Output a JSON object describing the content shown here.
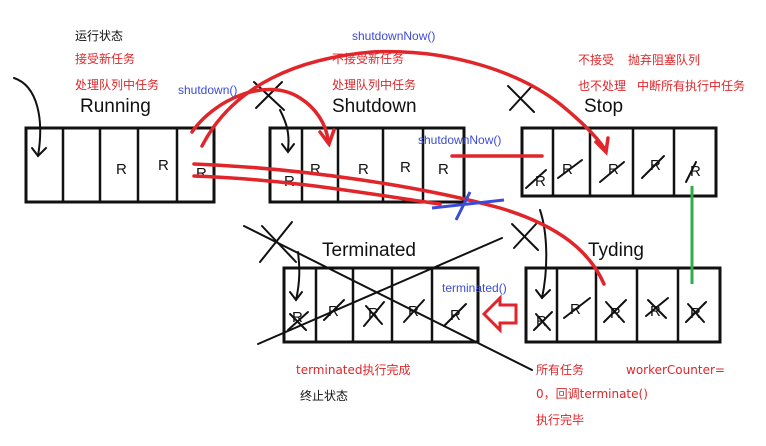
{
  "notes": {
    "running_state": "运行状态",
    "running_accept": "接受新任务",
    "running_process": "处理队列中任务",
    "shutdown_no_accept": "不接受新任务",
    "shutdown_process": "处理队列中任务",
    "stop_no_accept": "不接受",
    "stop_discard": "抛弃阻塞队列",
    "stop_no_process": "也不处理",
    "stop_interrupt": "中断所有执行中任务",
    "terminated_done": "terminated执行完成",
    "terminated_final": "终止状态",
    "tyding_all_tasks": "所有任务",
    "tyding_worker_counter": "workerCounter=",
    "tyding_callback": "0，回调terminate()",
    "tyding_done": "执行完毕"
  },
  "states": {
    "running": "Running",
    "shutdown": "Shutdown",
    "stop": "Stop",
    "terminated": "Terminated",
    "tyding": "Tyding"
  },
  "transitions": {
    "shutdown_call": "shutdown()",
    "shutdown_now_call_top": "shutdownNow()",
    "shutdown_now_call_mid": "shutdownNow()",
    "terminated_call": "terminated()"
  },
  "cells": {
    "running": [
      "",
      "",
      "R",
      "R",
      "R"
    ],
    "shutdown": [
      "R",
      "R",
      "R",
      "R",
      "R"
    ],
    "stop": [
      "R",
      "R",
      "R",
      "R",
      "R"
    ],
    "terminated": [
      "R",
      "R",
      "R",
      "R",
      "R"
    ],
    "tyding": [
      "R",
      "R",
      "R",
      "R",
      "R"
    ]
  },
  "colors": {
    "red": "#e0262a",
    "blue": "#3c4bd8",
    "green": "#2fae4a",
    "black": "#111111"
  }
}
